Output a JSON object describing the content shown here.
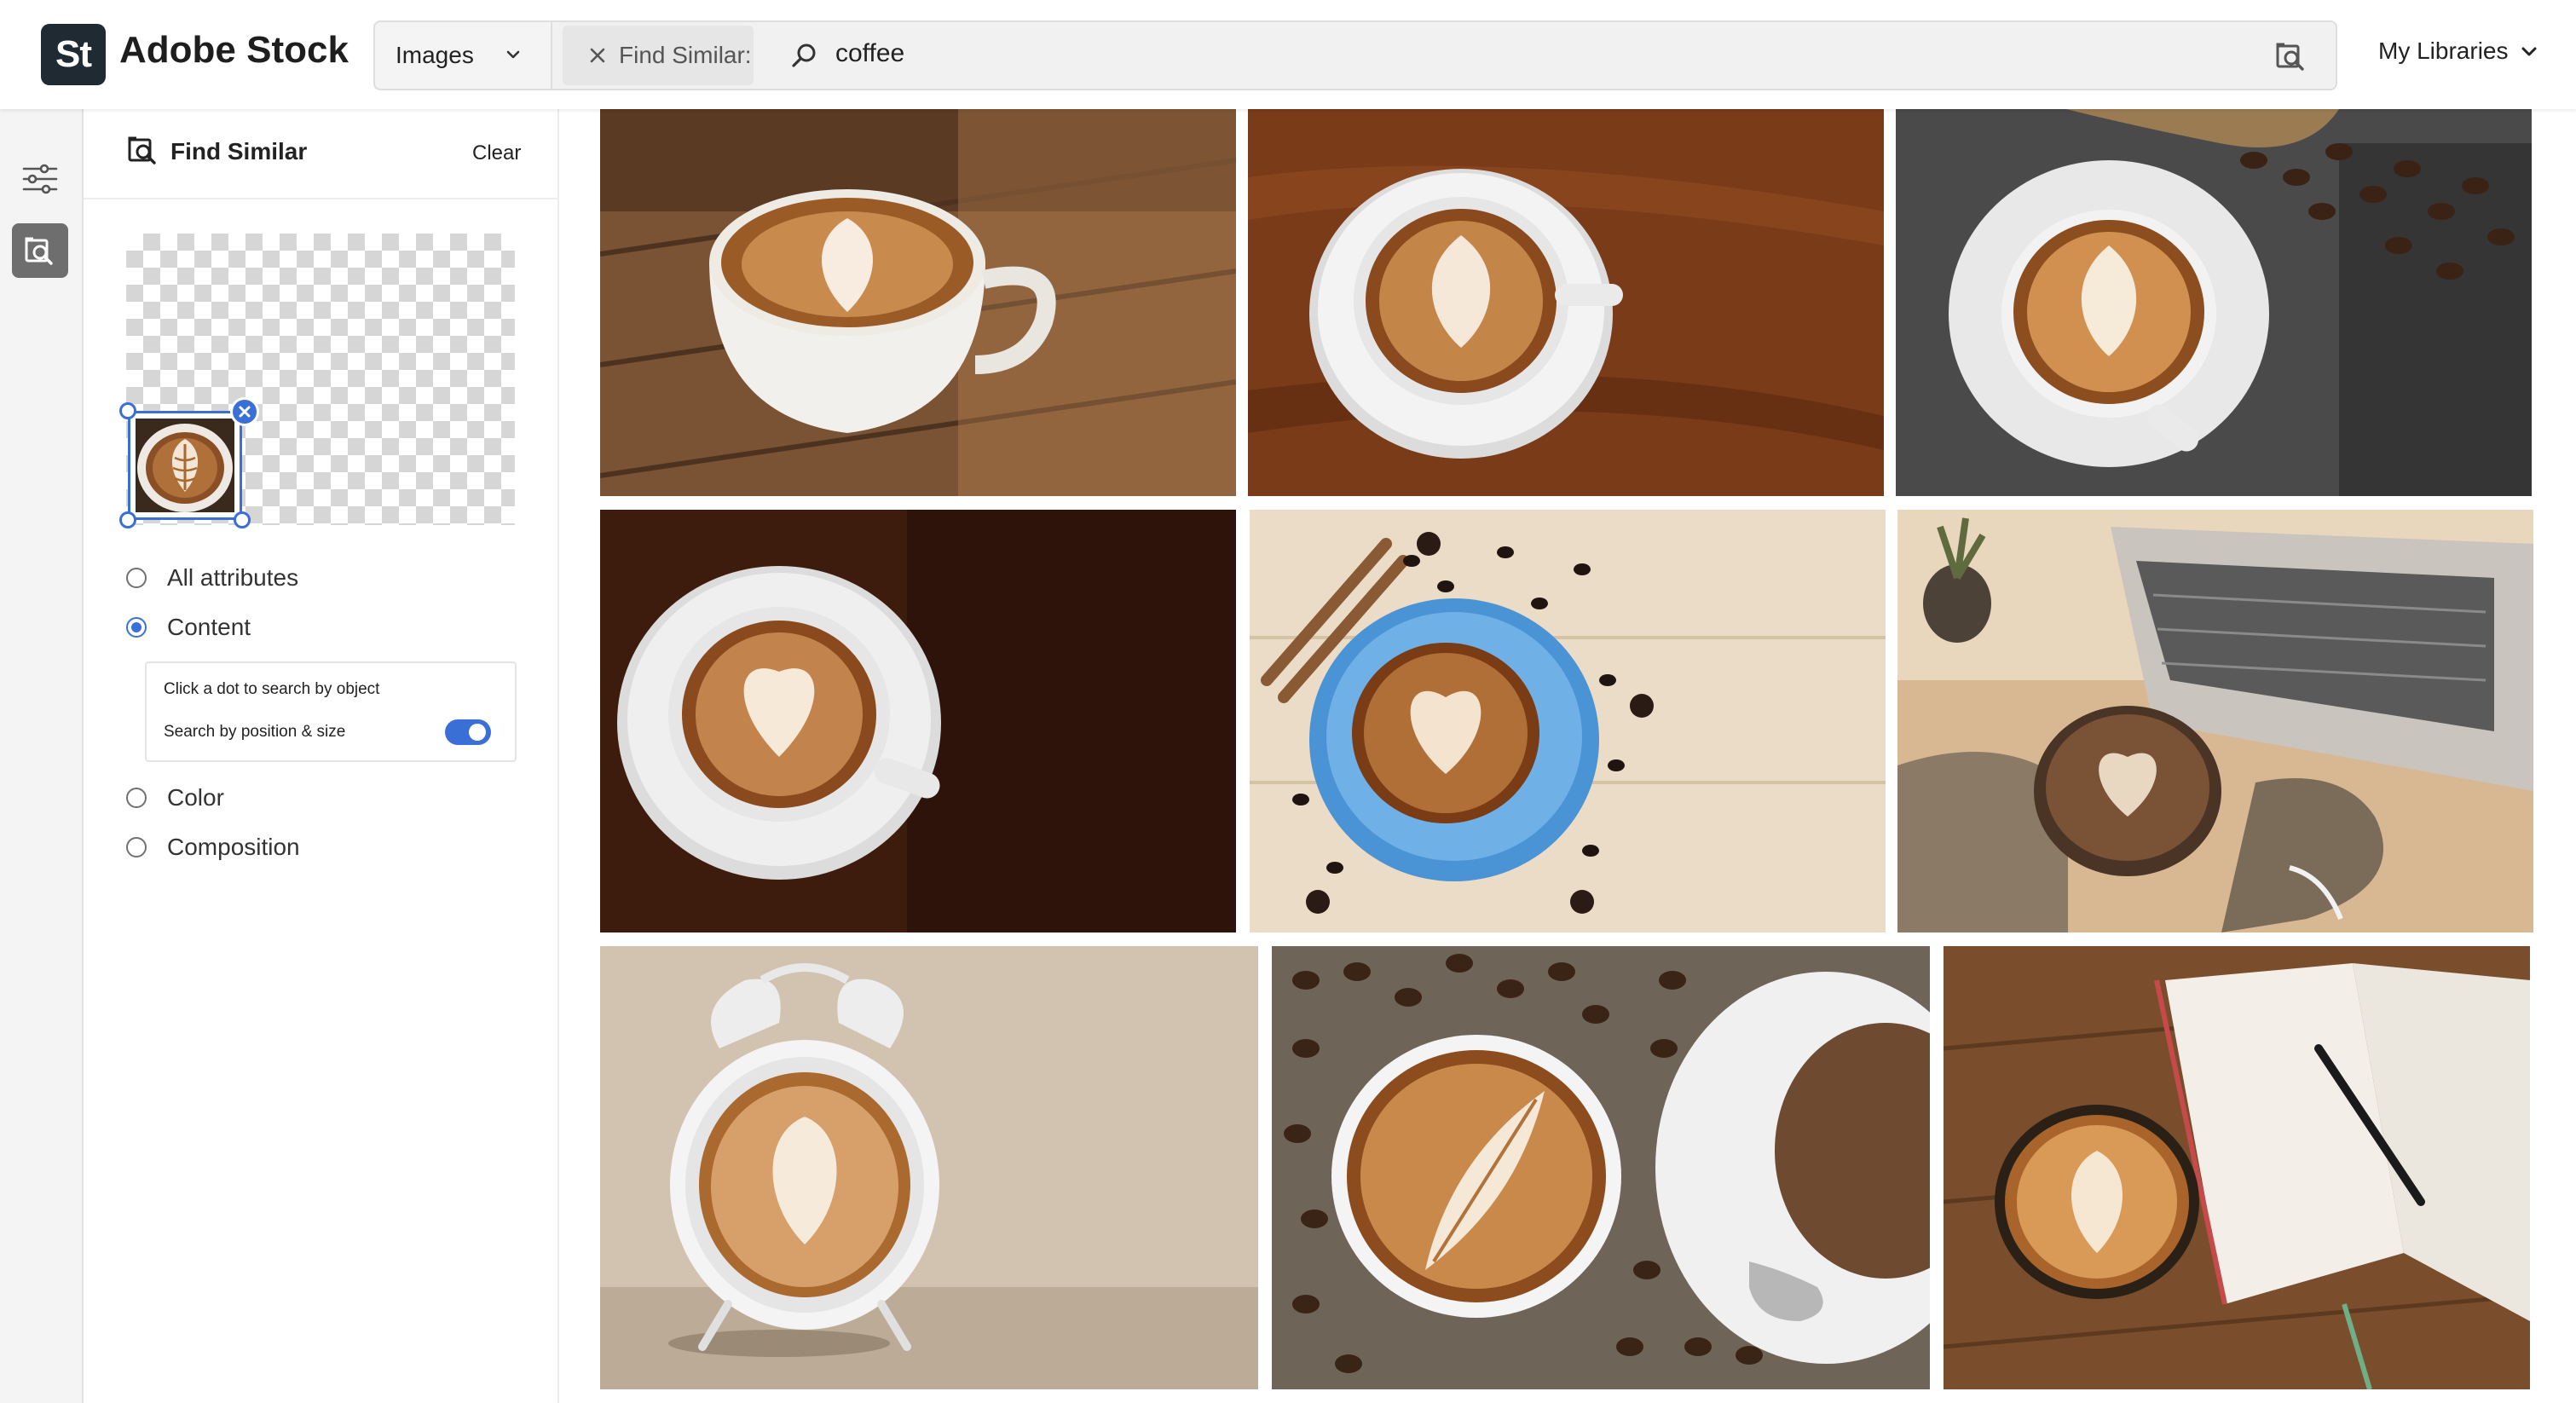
{
  "header": {
    "logo": "St",
    "brand": "Adobe Stock",
    "asset_type": "Images",
    "find_similar_chip": "Find Similar:",
    "query": "coffee",
    "my_libraries": "My Libraries"
  },
  "panel": {
    "title": "Find Similar",
    "clear": "Clear",
    "options": [
      {
        "label": "All attributes",
        "selected": false
      },
      {
        "label": "Content",
        "selected": true
      },
      {
        "label": "Color",
        "selected": false
      },
      {
        "label": "Composition",
        "selected": false
      }
    ],
    "content_box": {
      "hint": "Click a dot to search by object",
      "toggle_label": "Search by position & size",
      "toggle_on": true
    }
  },
  "colors": {
    "accent": "#3a6fd8",
    "logo_bg": "#1f2a33"
  },
  "icons": [
    "chevron-down-icon",
    "close-icon",
    "search-icon",
    "visual-search-icon",
    "filters-icon"
  ],
  "results": [
    {
      "subject": "latte on wooden table, side view"
    },
    {
      "subject": "latte on dark wood, top view"
    },
    {
      "subject": "latte with coffee beans on dark surface"
    },
    {
      "subject": "latte on dark brown background"
    },
    {
      "subject": "latte in blue cup with spices"
    },
    {
      "subject": "hand holding latte near laptop"
    },
    {
      "subject": "alarm clock with latte face"
    },
    {
      "subject": "latte surrounded by coffee beans"
    },
    {
      "subject": "latte next to open notebook"
    }
  ]
}
